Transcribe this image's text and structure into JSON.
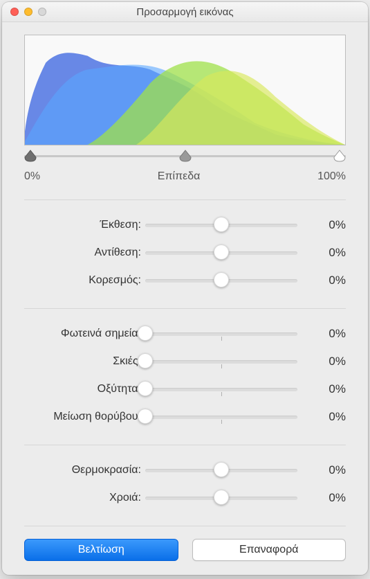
{
  "title": "Προσαρμογή εικόνας",
  "levels": {
    "left_label": "0%",
    "center_label": "Επίπεδα",
    "right_label": "100%"
  },
  "groups": [
    {
      "rows": [
        {
          "label": "Έκθεση:",
          "value": "0%",
          "pos": 0.5,
          "tick": 0.5
        },
        {
          "label": "Αντίθεση:",
          "value": "0%",
          "pos": 0.5,
          "tick": 0.5
        },
        {
          "label": "Κορεσμός:",
          "value": "0%",
          "pos": 0.5,
          "tick": 0.5
        }
      ]
    },
    {
      "rows": [
        {
          "label": "Φωτεινά σημεία:",
          "value": "0%",
          "pos": 0.0,
          "tick": 0.5
        },
        {
          "label": "Σκιές:",
          "value": "0%",
          "pos": 0.0,
          "tick": 0.5
        },
        {
          "label": "Οξύτητα:",
          "value": "0%",
          "pos": 0.0,
          "tick": 0.5
        },
        {
          "label": "Μείωση θορύβου:",
          "value": "0%",
          "pos": 0.0,
          "tick": 0.5
        }
      ]
    },
    {
      "rows": [
        {
          "label": "Θερμοκρασία:",
          "value": "0%",
          "pos": 0.5,
          "tick": 0.5
        },
        {
          "label": "Χροιά:",
          "value": "0%",
          "pos": 0.5,
          "tick": 0.5
        }
      ]
    }
  ],
  "buttons": {
    "enhance": "Βελτίωση",
    "reset": "Επαναφορά"
  }
}
